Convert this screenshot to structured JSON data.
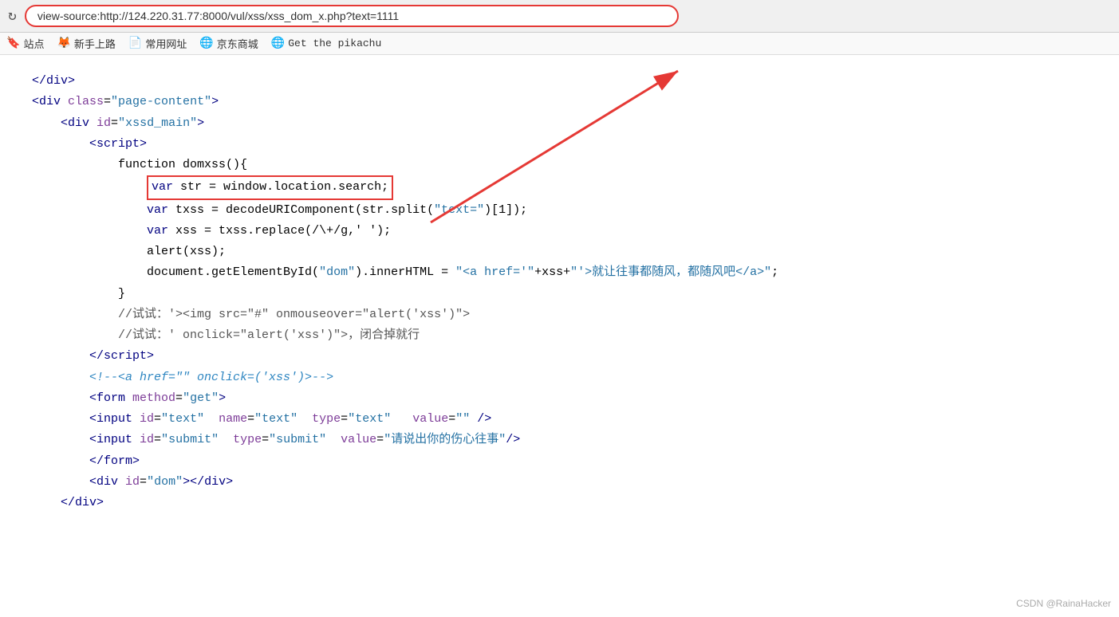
{
  "browser": {
    "reload_icon": "↻",
    "address_bar_value": "view-source:http://124.220.31.77:8000/vul/xss/xss_dom_x.php?text=1111"
  },
  "bookmarks": [
    {
      "icon": "🔖",
      "label": "站点"
    },
    {
      "icon": "🦊",
      "label": "新手上路"
    },
    {
      "icon": "📄",
      "label": "常用网址"
    },
    {
      "icon": "🌐",
      "label": "京东商城"
    },
    {
      "icon": "🌐",
      "label": "Get the pikachu"
    }
  ],
  "watermark": "CSDN @RainaHacker"
}
